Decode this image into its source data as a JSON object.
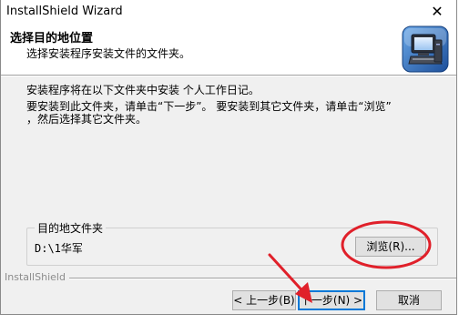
{
  "window": {
    "title": "InstallShield Wizard",
    "close_glyph": "✕"
  },
  "header": {
    "heading": "选择目的地位置",
    "subheading": "选择安装程序安装文件的文件夹。",
    "logo_icon": "installshield-computer-icon"
  },
  "body": {
    "line1": "安装程序将在以下文件夹中安装 个人工作日记。",
    "line2a": "要安装到此文件夹，请单击“下一步”。 要安装到其它文件夹，请单击“浏览”",
    "line2b": "，然后选择其它文件夹。"
  },
  "destination": {
    "label": "目的地文件夹",
    "path": "D:\\1华军",
    "browse_label": "浏览(R)..."
  },
  "footer": {
    "brand": "InstallShield",
    "back_label": "< 上一步(B)",
    "next_label": "下一步(N) >",
    "cancel_label": "取消"
  },
  "annotations": {
    "color": "#e0202a",
    "arrow_target": "next-button",
    "circle_target": "browse-button"
  }
}
